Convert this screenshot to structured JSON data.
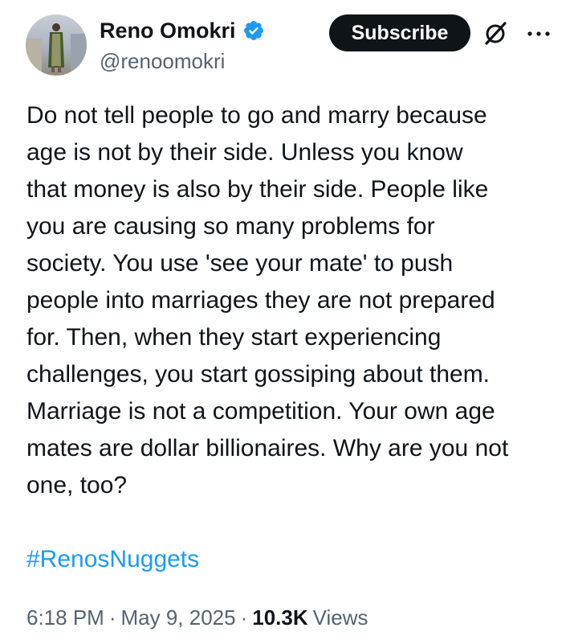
{
  "author": {
    "display_name": "Reno Omokri",
    "handle": "@renoomokri",
    "verified": true,
    "verified_color": "#1d9bf0",
    "avatar_icon": "profile-photo"
  },
  "actions": {
    "subscribe_label": "Subscribe",
    "grok_icon": "grok-icon",
    "more_icon": "more-horizontal-icon"
  },
  "tweet": {
    "text": "Do not tell people to go and marry because\nage is not by their side. Unless you know\nthat money is also by their side. People like\nyou are causing so many problems for\nsociety. You use 'see your mate' to push\npeople into marriages they are not prepared\nfor. Then, when they start experiencing\nchallenges, you start gossiping about them.\nMarriage is not a competition. Your own age\nmates are dollar billionaires. Why are you not\none, too?",
    "hashtag": "#RenosNuggets",
    "hashtag_color": "#1d9bf0"
  },
  "meta": {
    "time": "6:18 PM",
    "separator": "·",
    "date": "May 9, 2025",
    "views_count": "10.3K",
    "views_label": "Views"
  }
}
